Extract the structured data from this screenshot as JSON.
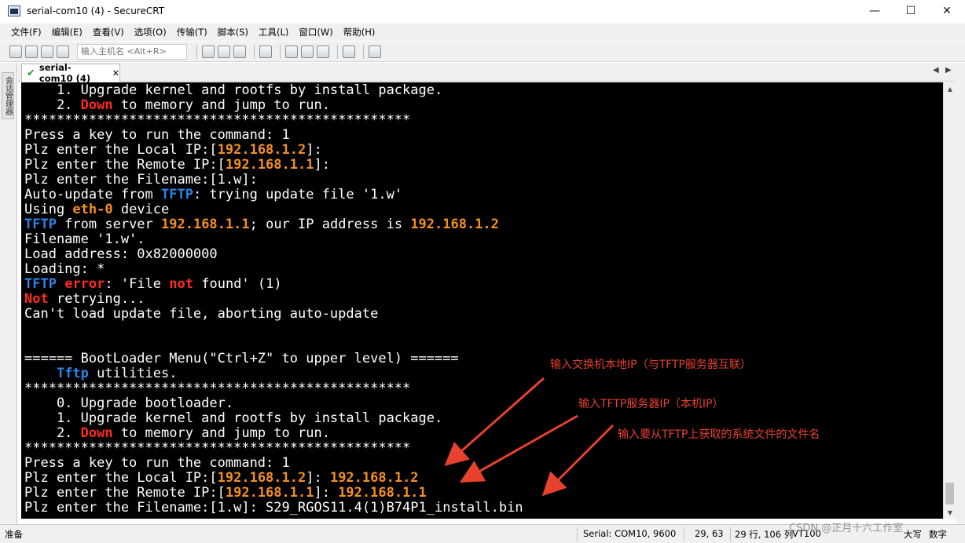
{
  "window": {
    "title": "serial-com10 (4) - SecureCRT",
    "minimize": "—",
    "maximize": "☐",
    "close": "✕"
  },
  "menu": [
    "文件(F)",
    "编辑(E)",
    "查看(V)",
    "选项(O)",
    "传输(T)",
    "脚本(S)",
    "工具(L)",
    "窗口(W)",
    "帮助(H)"
  ],
  "toolbar": {
    "host_placeholder": "输入主机名 <Alt+R>"
  },
  "sidebar": {
    "session_manager_label": "会话管理器"
  },
  "tab": {
    "label": "serial-com10 (4)",
    "close": "✕",
    "scroll_left": "◀",
    "scroll_right": "▶"
  },
  "terminal": {
    "lines": [
      [
        {
          "t": "    1. Upgrade kernel and rootfs by install package."
        }
      ],
      [
        {
          "t": "    2. "
        },
        {
          "t": "Down",
          "c": "red"
        },
        {
          "t": " to memory and jump to run."
        }
      ],
      [
        {
          "t": "************************************************"
        }
      ],
      [
        {
          "t": "Press a key to run the command: 1"
        }
      ],
      [
        {
          "t": "Plz enter the Local IP:["
        },
        {
          "t": "192.168.1.2",
          "c": "orange"
        },
        {
          "t": "]:"
        }
      ],
      [
        {
          "t": "Plz enter the Remote IP:["
        },
        {
          "t": "192.168.1.1",
          "c": "orange"
        },
        {
          "t": "]:"
        }
      ],
      [
        {
          "t": "Plz enter the Filename:[1.w]:"
        }
      ],
      [
        {
          "t": "Auto-update from "
        },
        {
          "t": "TFTP",
          "c": "blue"
        },
        {
          "t": ": trying update file '1.w'"
        }
      ],
      [
        {
          "t": "Using "
        },
        {
          "t": "eth-0",
          "c": "orange"
        },
        {
          "t": " device"
        }
      ],
      [
        {
          "t": "TFTP",
          "c": "blue"
        },
        {
          "t": " from server "
        },
        {
          "t": "192.168.1.1",
          "c": "orange"
        },
        {
          "t": "; our IP address is "
        },
        {
          "t": "192.168.1.2",
          "c": "orange"
        }
      ],
      [
        {
          "t": "Filename '1.w'."
        }
      ],
      [
        {
          "t": "Load address: 0x82000000"
        }
      ],
      [
        {
          "t": "Loading: *"
        }
      ],
      [
        {
          "t": "TFTP",
          "c": "blue"
        },
        {
          "t": " "
        },
        {
          "t": "error",
          "c": "red"
        },
        {
          "t": ": 'File "
        },
        {
          "t": "not",
          "c": "red"
        },
        {
          "t": " found' (1)"
        }
      ],
      [
        {
          "t": "Not",
          "c": "red"
        },
        {
          "t": " retrying..."
        }
      ],
      [
        {
          "t": "Can't load update file, aborting auto-update"
        }
      ],
      [
        {
          "t": ""
        }
      ],
      [
        {
          "t": ""
        }
      ],
      [
        {
          "t": "====== BootLoader Menu(\"Ctrl+Z\" to upper level) ======"
        }
      ],
      [
        {
          "t": "    "
        },
        {
          "t": "Tftp",
          "c": "blue"
        },
        {
          "t": " utilities."
        }
      ],
      [
        {
          "t": "************************************************"
        }
      ],
      [
        {
          "t": "    0. Upgrade bootloader."
        }
      ],
      [
        {
          "t": "    1. Upgrade kernel and rootfs by install package."
        }
      ],
      [
        {
          "t": "    2. "
        },
        {
          "t": "Down",
          "c": "red"
        },
        {
          "t": " to memory and jump to run."
        }
      ],
      [
        {
          "t": "************************************************"
        }
      ],
      [
        {
          "t": "Press a key to run the command: 1"
        }
      ],
      [
        {
          "t": "Plz enter the Local IP:["
        },
        {
          "t": "192.168.1.2",
          "c": "orange"
        },
        {
          "t": "]: "
        },
        {
          "t": "192.168.1.2",
          "c": "orange"
        }
      ],
      [
        {
          "t": "Plz enter the Remote IP:["
        },
        {
          "t": "192.168.1.1",
          "c": "orange"
        },
        {
          "t": "]: "
        },
        {
          "t": "192.168.1.1",
          "c": "orange"
        }
      ],
      [
        {
          "t": "Plz enter the Filename:[1.w]: S29_RGOS11.4(1)B74P1_install.bin"
        }
      ]
    ]
  },
  "annotations": [
    "输入交换机本地IP（与TFTP服务器互联）",
    "输入TFTP服务器IP（本机IP）",
    "输入要从TFTP上获取的系统文件的文件名"
  ],
  "status": {
    "ready": "准备",
    "connection": "Serial: COM10, 9600",
    "cursor": "29,  63",
    "rows_cols": "29 行, 106 列",
    "terminal_type": "VT100",
    "caps": "大写",
    "num": "数字",
    "watermark": "CSDN @正月十六工作室"
  },
  "colors": {
    "terminal_bg": "#000000",
    "terminal_fg": "#ffffff",
    "red": "#ff2a1e",
    "orange": "#f5901e",
    "blue": "#2b85e8",
    "annotation": "#e8412e"
  }
}
